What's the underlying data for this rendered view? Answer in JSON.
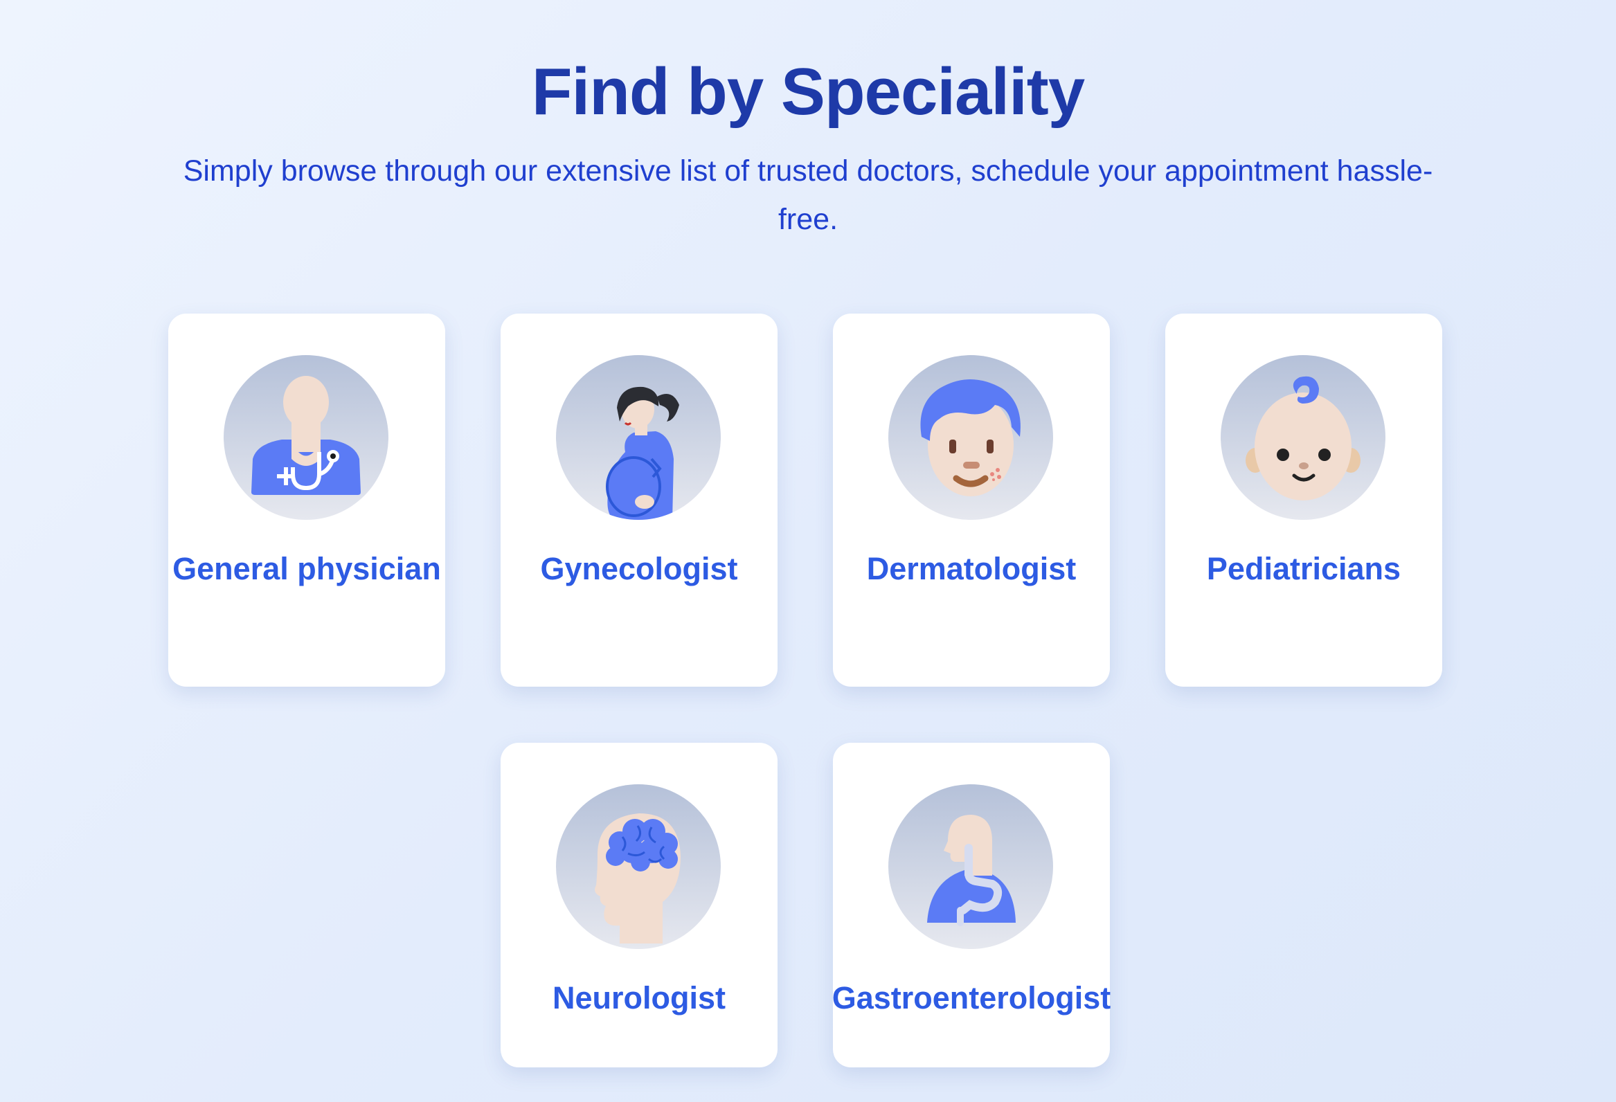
{
  "section": {
    "title": "Find by Speciality",
    "subtitle": "Simply browse through our extensive list of trusted doctors, schedule your appointment hassle-free."
  },
  "specialities": [
    {
      "label": "General physician",
      "icon": "doctor-stethoscope-icon"
    },
    {
      "label": "Gynecologist",
      "icon": "pregnant-woman-icon"
    },
    {
      "label": "Dermatologist",
      "icon": "face-with-skin-spots-icon"
    },
    {
      "label": "Pediatricians",
      "icon": "baby-face-icon"
    },
    {
      "label": "Neurologist",
      "icon": "head-brain-icon"
    },
    {
      "label": "Gastroenterologist",
      "icon": "digestive-system-icon"
    }
  ],
  "colors": {
    "title": "#1e3aa8",
    "subtitle": "#1f3fcf",
    "label": "#2d5be3",
    "icon_blue": "#5b7bf5",
    "skin": "#f2ddd0"
  }
}
